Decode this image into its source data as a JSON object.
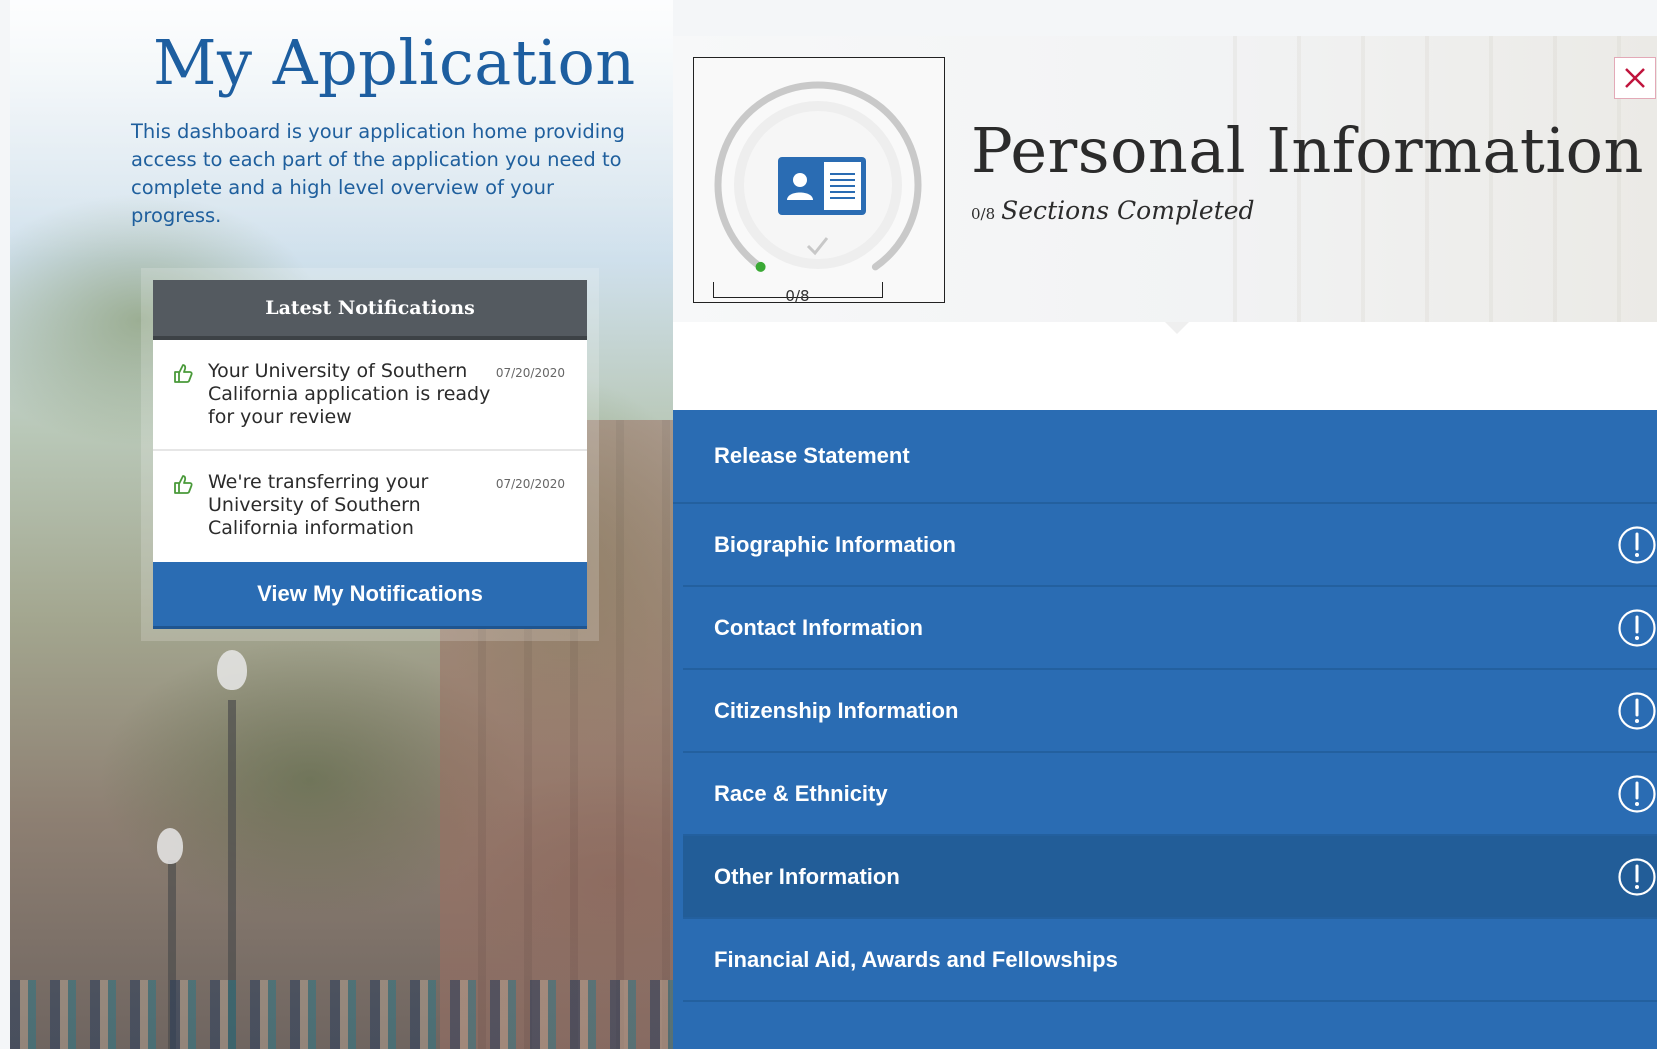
{
  "page": {
    "title": "My Application",
    "description": "This dashboard is your application home providing access to each part of the application you need to complete and a high level overview of your progress."
  },
  "notifications": {
    "header": "Latest Notifications",
    "items": [
      {
        "text": "Your University of Southern California application is ready for your review",
        "date": "07/20/2020",
        "icon": "thumbs-up-icon"
      },
      {
        "text": "We're transferring your University of Southern California information",
        "date": "07/20/2020",
        "icon": "thumbs-up-icon"
      }
    ],
    "button_label": "View My Notifications"
  },
  "section": {
    "title": "Personal Information",
    "completed_count": "0/8",
    "completed_label": "Sections Completed",
    "progress_label": "0/8",
    "progress_fraction": 0,
    "icon": "id-card-icon",
    "close_icon": "close-icon"
  },
  "subsections": [
    {
      "label": "Release Statement",
      "alert": false,
      "active": false
    },
    {
      "label": "Biographic Information",
      "alert": true,
      "active": false
    },
    {
      "label": "Contact Information",
      "alert": true,
      "active": false
    },
    {
      "label": "Citizenship Information",
      "alert": true,
      "active": false
    },
    {
      "label": "Race & Ethnicity",
      "alert": true,
      "active": false
    },
    {
      "label": "Other Information",
      "alert": true,
      "active": true
    },
    {
      "label": "Financial Aid, Awards and Fellowships",
      "alert": false,
      "active": false
    }
  ],
  "colors": {
    "primary_blue": "#2a6cb3",
    "active_row": "#225d98",
    "title_blue": "#1d5ea0",
    "notification_header": "#545a60",
    "close_red": "#c0143c",
    "progress_start_dot": "#3aa935",
    "notification_icon": "#4a9a3a"
  }
}
